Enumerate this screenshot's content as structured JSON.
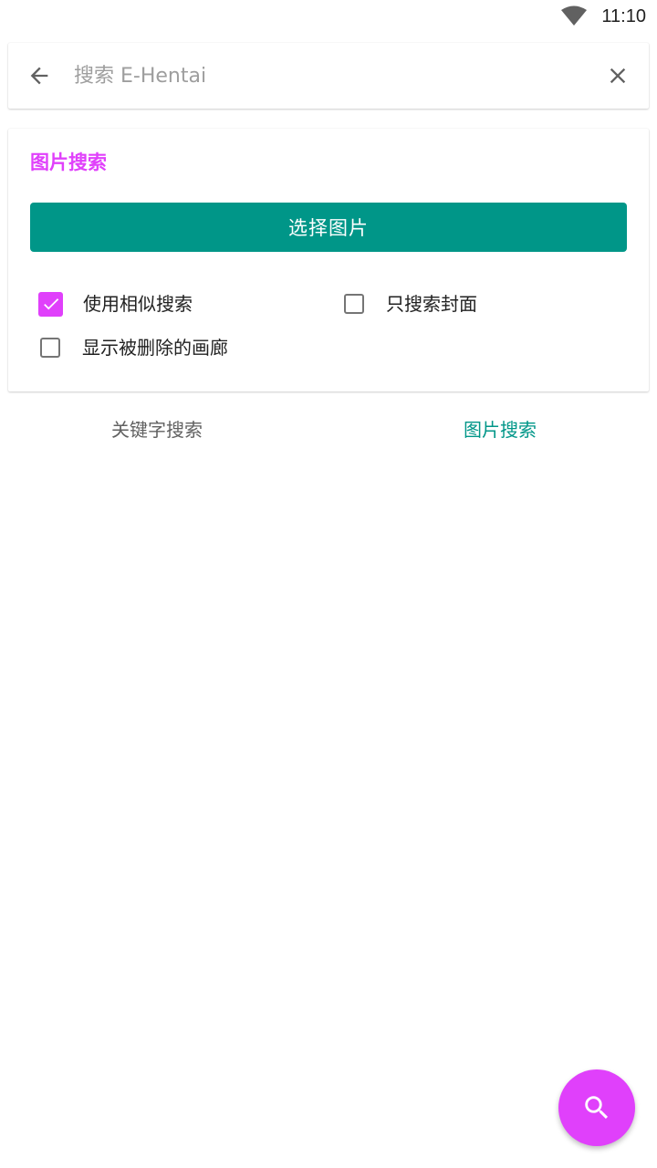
{
  "status_bar": {
    "time": "11:10",
    "wifi_icon": "wifi-icon"
  },
  "search_bar": {
    "back_icon": "arrow-back-icon",
    "placeholder": "搜索 E-Hentai",
    "value": "",
    "clear_icon": "close-icon"
  },
  "image_search_panel": {
    "title": "图片搜索",
    "select_button_label": "选择图片",
    "options": [
      {
        "label": "使用相似搜索",
        "checked": true
      },
      {
        "label": "只搜索封面",
        "checked": false
      },
      {
        "label": "显示被删除的画廊",
        "checked": false
      }
    ]
  },
  "tabs": [
    {
      "label": "关键字搜索",
      "active": false
    },
    {
      "label": "图片搜索",
      "active": true
    }
  ],
  "fab": {
    "icon": "search-icon"
  },
  "colors": {
    "accent": "#e040fb",
    "primary": "#009688",
    "tab_inactive": "#616161",
    "icon_gray": "#616161",
    "checkbox_border": "#757575"
  }
}
